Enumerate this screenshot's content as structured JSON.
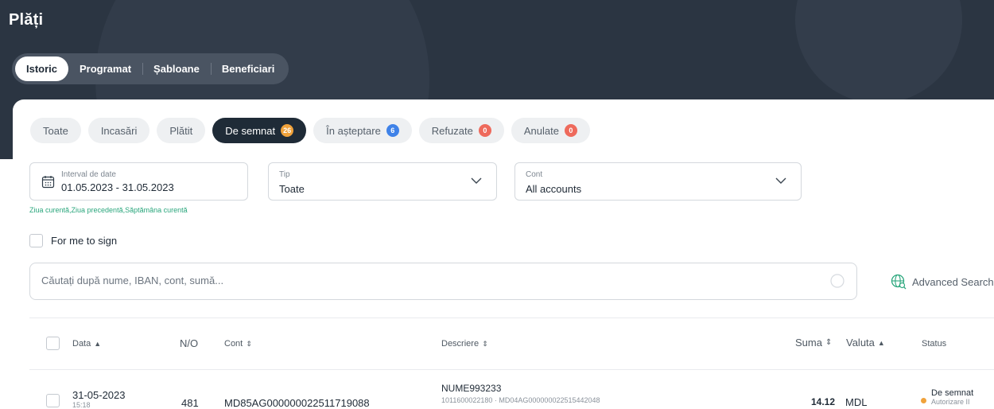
{
  "page": {
    "title": "Plăți"
  },
  "main_tabs": [
    "Istoric",
    "Programat",
    "Șabloane",
    "Beneficiari"
  ],
  "filters": [
    {
      "label": "Toate",
      "badge": null,
      "badge_color": null
    },
    {
      "label": "Incasări",
      "badge": null,
      "badge_color": null
    },
    {
      "label": "Plătit",
      "badge": null,
      "badge_color": null
    },
    {
      "label": "De semnat",
      "badge": "26",
      "badge_color": "orange"
    },
    {
      "label": "În așteptare",
      "badge": "6",
      "badge_color": "blue"
    },
    {
      "label": "Refuzate",
      "badge": "0",
      "badge_color": "red"
    },
    {
      "label": "Anulate",
      "badge": "0",
      "badge_color": "red"
    }
  ],
  "active_filter": "De semnat",
  "date_field": {
    "label": "Interval de date",
    "value": "01.05.2023 - 31.05.2023"
  },
  "type_field": {
    "label": "Tip",
    "value": "Toate"
  },
  "account_field": {
    "label": "Cont",
    "value": "All accounts"
  },
  "quick_dates": "Ziua curentă,Ziua precedentă,Săptămâna curentă",
  "for_me_to_sign": "For me to sign",
  "search": {
    "placeholder": "Căutați după nume, IBAN, cont, sumă..."
  },
  "advanced_search": "Advanced Search",
  "table": {
    "headers": {
      "data": "Data",
      "no": "N/O",
      "cont": "Cont",
      "descriere": "Descriere",
      "suma": "Suma",
      "valuta": "Valuta",
      "status": "Status"
    },
    "rows": [
      {
        "date": "31-05-2023",
        "time": "15:18",
        "no": "481",
        "account": "MD85AG000000022511719088",
        "desc_name": "NUME993233",
        "desc_detail": "1011600022180 · MD04AG000000022515442048",
        "amount": "14.12",
        "currency": "MDL",
        "status": "De semnat",
        "status_sub": "Autorizare II"
      }
    ]
  },
  "colors": {
    "header_bg": "#2b3542",
    "active_chip": "#1f2b37",
    "link_green": "#2aa67c",
    "status_dot": "#f0a23b"
  }
}
